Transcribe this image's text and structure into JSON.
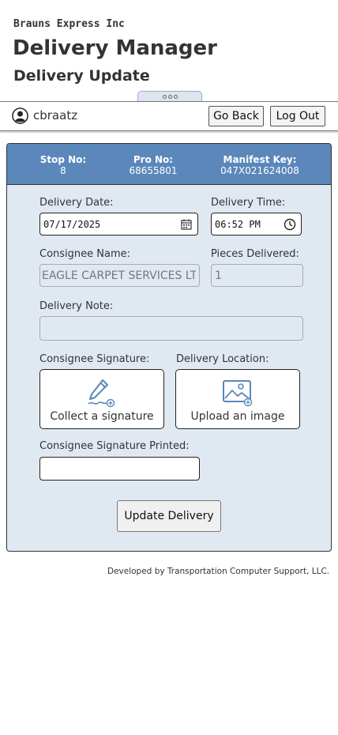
{
  "header": {
    "company": "Brauns Express Inc",
    "app_title": "Delivery Manager",
    "page_title": "Delivery Update"
  },
  "topbar": {
    "username": "cbraatz",
    "go_back_label": "Go Back",
    "logout_label": "Log Out"
  },
  "stop_info": {
    "stop_label": "Stop No:",
    "stop_value": "8",
    "pro_label": "Pro No:",
    "pro_value": "68655801",
    "manifest_label": "Manifest Key:",
    "manifest_value": "047X021624008"
  },
  "form": {
    "delivery_date_label": "Delivery Date:",
    "delivery_date_value": "07/17/2025",
    "delivery_time_label": "Delivery Time:",
    "delivery_time_value": "06:52 PM",
    "consignee_name_label": "Consignee Name:",
    "consignee_name_value": "EAGLE CARPET SERVICES LTD",
    "pieces_label": "Pieces Delivered:",
    "pieces_value": "1",
    "note_label": "Delivery Note:",
    "note_value": "",
    "signature_label": "Consignee Signature:",
    "signature_action": "Collect a signature",
    "location_label": "Delivery Location:",
    "location_action": "Upload an image",
    "printed_label": "Consignee Signature Printed:",
    "printed_value": "",
    "update_label": "Update Delivery"
  },
  "footer": {
    "text": "Developed by Transportation Computer Support, LLC."
  },
  "colors": {
    "header_band": "#5b87bb",
    "card_background": "#e0e9f2",
    "icon_blue": "#5b87bb"
  }
}
